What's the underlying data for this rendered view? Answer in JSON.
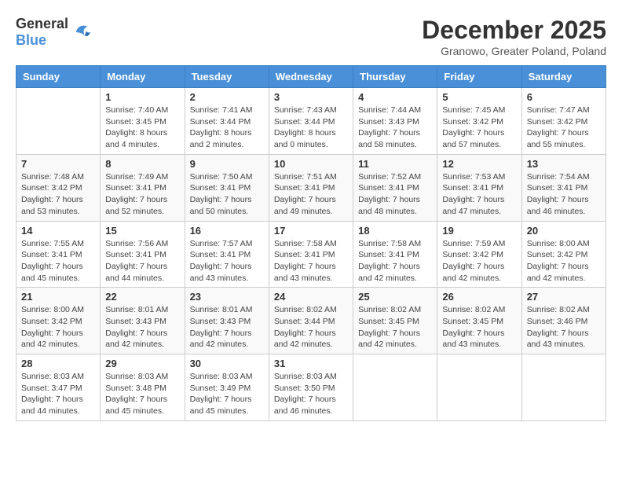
{
  "header": {
    "logo_general": "General",
    "logo_blue": "Blue",
    "month_title": "December 2025",
    "subtitle": "Granowo, Greater Poland, Poland"
  },
  "days_of_week": [
    "Sunday",
    "Monday",
    "Tuesday",
    "Wednesday",
    "Thursday",
    "Friday",
    "Saturday"
  ],
  "weeks": [
    [
      {
        "day": "",
        "text": ""
      },
      {
        "day": "1",
        "text": "Sunrise: 7:40 AM\nSunset: 3:45 PM\nDaylight: 8 hours\nand 4 minutes."
      },
      {
        "day": "2",
        "text": "Sunrise: 7:41 AM\nSunset: 3:44 PM\nDaylight: 8 hours\nand 2 minutes."
      },
      {
        "day": "3",
        "text": "Sunrise: 7:43 AM\nSunset: 3:44 PM\nDaylight: 8 hours\nand 0 minutes."
      },
      {
        "day": "4",
        "text": "Sunrise: 7:44 AM\nSunset: 3:43 PM\nDaylight: 7 hours\nand 58 minutes."
      },
      {
        "day": "5",
        "text": "Sunrise: 7:45 AM\nSunset: 3:42 PM\nDaylight: 7 hours\nand 57 minutes."
      },
      {
        "day": "6",
        "text": "Sunrise: 7:47 AM\nSunset: 3:42 PM\nDaylight: 7 hours\nand 55 minutes."
      }
    ],
    [
      {
        "day": "7",
        "text": "Sunrise: 7:48 AM\nSunset: 3:42 PM\nDaylight: 7 hours\nand 53 minutes."
      },
      {
        "day": "8",
        "text": "Sunrise: 7:49 AM\nSunset: 3:41 PM\nDaylight: 7 hours\nand 52 minutes."
      },
      {
        "day": "9",
        "text": "Sunrise: 7:50 AM\nSunset: 3:41 PM\nDaylight: 7 hours\nand 50 minutes."
      },
      {
        "day": "10",
        "text": "Sunrise: 7:51 AM\nSunset: 3:41 PM\nDaylight: 7 hours\nand 49 minutes."
      },
      {
        "day": "11",
        "text": "Sunrise: 7:52 AM\nSunset: 3:41 PM\nDaylight: 7 hours\nand 48 minutes."
      },
      {
        "day": "12",
        "text": "Sunrise: 7:53 AM\nSunset: 3:41 PM\nDaylight: 7 hours\nand 47 minutes."
      },
      {
        "day": "13",
        "text": "Sunrise: 7:54 AM\nSunset: 3:41 PM\nDaylight: 7 hours\nand 46 minutes."
      }
    ],
    [
      {
        "day": "14",
        "text": "Sunrise: 7:55 AM\nSunset: 3:41 PM\nDaylight: 7 hours\nand 45 minutes."
      },
      {
        "day": "15",
        "text": "Sunrise: 7:56 AM\nSunset: 3:41 PM\nDaylight: 7 hours\nand 44 minutes."
      },
      {
        "day": "16",
        "text": "Sunrise: 7:57 AM\nSunset: 3:41 PM\nDaylight: 7 hours\nand 43 minutes."
      },
      {
        "day": "17",
        "text": "Sunrise: 7:58 AM\nSunset: 3:41 PM\nDaylight: 7 hours\nand 43 minutes."
      },
      {
        "day": "18",
        "text": "Sunrise: 7:58 AM\nSunset: 3:41 PM\nDaylight: 7 hours\nand 42 minutes."
      },
      {
        "day": "19",
        "text": "Sunrise: 7:59 AM\nSunset: 3:42 PM\nDaylight: 7 hours\nand 42 minutes."
      },
      {
        "day": "20",
        "text": "Sunrise: 8:00 AM\nSunset: 3:42 PM\nDaylight: 7 hours\nand 42 minutes."
      }
    ],
    [
      {
        "day": "21",
        "text": "Sunrise: 8:00 AM\nSunset: 3:42 PM\nDaylight: 7 hours\nand 42 minutes."
      },
      {
        "day": "22",
        "text": "Sunrise: 8:01 AM\nSunset: 3:43 PM\nDaylight: 7 hours\nand 42 minutes."
      },
      {
        "day": "23",
        "text": "Sunrise: 8:01 AM\nSunset: 3:43 PM\nDaylight: 7 hours\nand 42 minutes."
      },
      {
        "day": "24",
        "text": "Sunrise: 8:02 AM\nSunset: 3:44 PM\nDaylight: 7 hours\nand 42 minutes."
      },
      {
        "day": "25",
        "text": "Sunrise: 8:02 AM\nSunset: 3:45 PM\nDaylight: 7 hours\nand 42 minutes."
      },
      {
        "day": "26",
        "text": "Sunrise: 8:02 AM\nSunset: 3:45 PM\nDaylight: 7 hours\nand 43 minutes."
      },
      {
        "day": "27",
        "text": "Sunrise: 8:02 AM\nSunset: 3:46 PM\nDaylight: 7 hours\nand 43 minutes."
      }
    ],
    [
      {
        "day": "28",
        "text": "Sunrise: 8:03 AM\nSunset: 3:47 PM\nDaylight: 7 hours\nand 44 minutes."
      },
      {
        "day": "29",
        "text": "Sunrise: 8:03 AM\nSunset: 3:48 PM\nDaylight: 7 hours\nand 45 minutes."
      },
      {
        "day": "30",
        "text": "Sunrise: 8:03 AM\nSunset: 3:49 PM\nDaylight: 7 hours\nand 45 minutes."
      },
      {
        "day": "31",
        "text": "Sunrise: 8:03 AM\nSunset: 3:50 PM\nDaylight: 7 hours\nand 46 minutes."
      },
      {
        "day": "",
        "text": ""
      },
      {
        "day": "",
        "text": ""
      },
      {
        "day": "",
        "text": ""
      }
    ]
  ]
}
